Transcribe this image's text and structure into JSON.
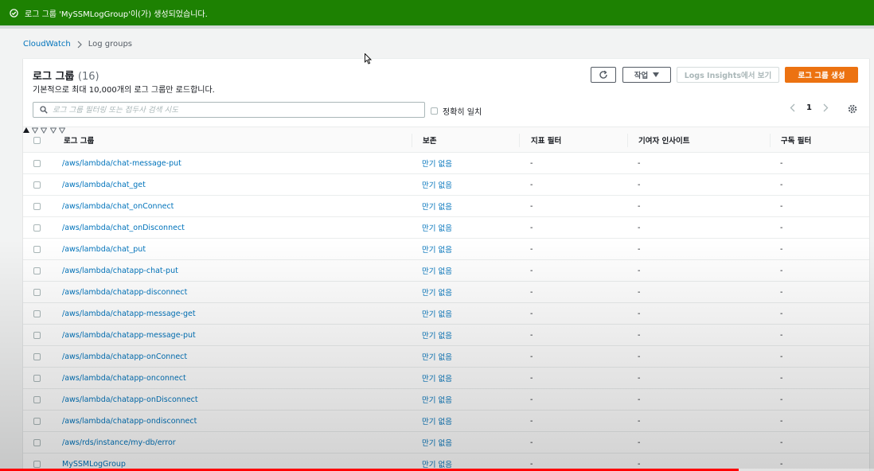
{
  "flash": {
    "message": "로그 그룹 'MySSMLogGroup'이(가) 생성되었습니다.",
    "color": "#1d8102"
  },
  "breadcrumb": {
    "root": "CloudWatch",
    "current": "Log groups"
  },
  "panel": {
    "title": "로그 그룹",
    "count": "(16)",
    "description": "기본적으로 최대 10,000개의 로그 그룹만 로드합니다."
  },
  "toolbar": {
    "refresh_icon": "refresh-icon",
    "actions_label": "작업",
    "insights_label": "Logs Insights에서 보기",
    "create_label": "로그 그룹 생성"
  },
  "search": {
    "placeholder": "로그 그룹 필터링 또는 접두사 검색 시도",
    "value": ""
  },
  "exact_match": {
    "label": "정확히 일치"
  },
  "pagination": {
    "current_page": "1"
  },
  "table": {
    "columns": [
      "로그 그룹",
      "보존",
      "지표 필터",
      "기여자 인사이트",
      "구독 필터"
    ],
    "rows": [
      {
        "name": "/aws/lambda/chat-message-put",
        "retention": "만기 없음",
        "metric": "-",
        "contributor": "-",
        "subscription": "-"
      },
      {
        "name": "/aws/lambda/chat_get",
        "retention": "만기 없음",
        "metric": "-",
        "contributor": "-",
        "subscription": "-"
      },
      {
        "name": "/aws/lambda/chat_onConnect",
        "retention": "만기 없음",
        "metric": "-",
        "contributor": "-",
        "subscription": "-"
      },
      {
        "name": "/aws/lambda/chat_onDisconnect",
        "retention": "만기 없음",
        "metric": "-",
        "contributor": "-",
        "subscription": "-"
      },
      {
        "name": "/aws/lambda/chat_put",
        "retention": "만기 없음",
        "metric": "-",
        "contributor": "-",
        "subscription": "-"
      },
      {
        "name": "/aws/lambda/chatapp-chat-put",
        "retention": "만기 없음",
        "metric": "-",
        "contributor": "-",
        "subscription": "-"
      },
      {
        "name": "/aws/lambda/chatapp-disconnect",
        "retention": "만기 없음",
        "metric": "-",
        "contributor": "-",
        "subscription": "-"
      },
      {
        "name": "/aws/lambda/chatapp-message-get",
        "retention": "만기 없음",
        "metric": "-",
        "contributor": "-",
        "subscription": "-"
      },
      {
        "name": "/aws/lambda/chatapp-message-put",
        "retention": "만기 없음",
        "metric": "-",
        "contributor": "-",
        "subscription": "-"
      },
      {
        "name": "/aws/lambda/chatapp-onConnect",
        "retention": "만기 없음",
        "metric": "-",
        "contributor": "-",
        "subscription": "-"
      },
      {
        "name": "/aws/lambda/chatapp-onconnect",
        "retention": "만기 없음",
        "metric": "-",
        "contributor": "-",
        "subscription": "-"
      },
      {
        "name": "/aws/lambda/chatapp-onDisconnect",
        "retention": "만기 없음",
        "metric": "-",
        "contributor": "-",
        "subscription": "-"
      },
      {
        "name": "/aws/lambda/chatapp-ondisconnect",
        "retention": "만기 없음",
        "metric": "-",
        "contributor": "-",
        "subscription": "-"
      },
      {
        "name": "/aws/rds/instance/my-db/error",
        "retention": "만기 없음",
        "metric": "-",
        "contributor": "-",
        "subscription": "-"
      },
      {
        "name": "MySSMLogGroup",
        "retention": "만기 없음",
        "metric": "-",
        "contributor": "-",
        "subscription": "-"
      }
    ]
  },
  "video_progress": {
    "fraction": 0.845,
    "color": "#ff0000"
  },
  "colors": {
    "link": "#0073bb",
    "primary": "#ec7211",
    "success": "#1d8102"
  }
}
